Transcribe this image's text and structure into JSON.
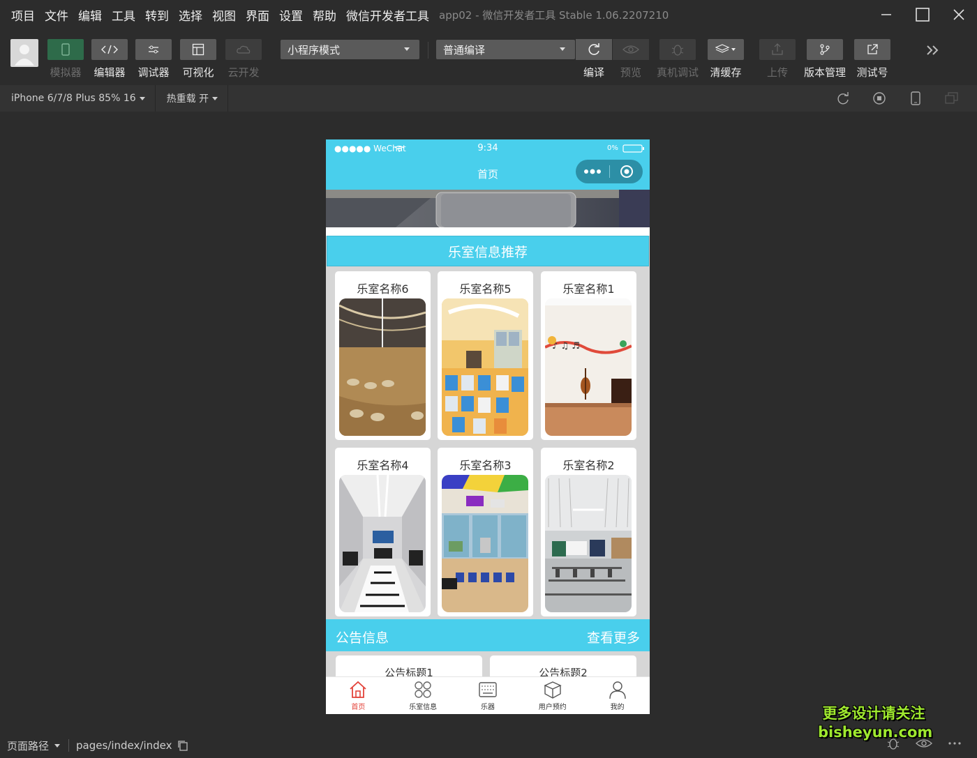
{
  "menubar": {
    "items": [
      "项目",
      "文件",
      "编辑",
      "工具",
      "转到",
      "选择",
      "视图",
      "界面",
      "设置",
      "帮助",
      "微信开发者工具"
    ],
    "app_title": "app02 - 微信开发者工具 Stable 1.06.2207210"
  },
  "toolbar": {
    "simulator": "模拟器",
    "editor": "编辑器",
    "debugger": "调试器",
    "visual": "可视化",
    "cloud": "云开发",
    "mode_select": "小程序模式",
    "compile_select": "普通编译",
    "compile": "编译",
    "preview": "预览",
    "real_debug": "真机调试",
    "clear_cache": "清缓存",
    "upload": "上传",
    "version": "版本管理",
    "test_account": "测试号"
  },
  "subbar": {
    "device": "iPhone 6/7/8 Plus 85% 16",
    "hot_reload": "热重载 开"
  },
  "phone": {
    "status": {
      "carrier": "●●●●● WeChat",
      "time": "9:34",
      "battery": "0%"
    },
    "nav_title": "首页",
    "rec_title": "乐室信息推荐",
    "rooms": [
      {
        "name": "乐室名称6",
        "image": "auditorium-steps"
      },
      {
        "name": "乐室名称5",
        "image": "classroom-desks"
      },
      {
        "name": "乐室名称1",
        "image": "music-wall-cello"
      },
      {
        "name": "乐室名称4",
        "image": "piano-room"
      },
      {
        "name": "乐室名称3",
        "image": "colorful-classroom"
      },
      {
        "name": "乐室名称2",
        "image": "lecture-hall"
      }
    ],
    "notice_title": "公告信息",
    "notice_more": "查看更多",
    "notices": [
      "公告标题1",
      "公告标题2"
    ],
    "tabs": [
      {
        "label": "首页",
        "icon": "home-icon",
        "selected": true
      },
      {
        "label": "乐室信息",
        "icon": "grid-icon",
        "selected": false
      },
      {
        "label": "乐器",
        "icon": "keyboard-icon",
        "selected": false
      },
      {
        "label": "用户预约",
        "icon": "box-icon",
        "selected": false
      },
      {
        "label": "我的",
        "icon": "user-icon",
        "selected": false
      }
    ],
    "accent_color": "#49cfec",
    "tab_selected_color": "#e3433a"
  },
  "bottombar": {
    "path_label": "页面路径",
    "path": "pages/index/index"
  },
  "watermark": {
    "line1": "更多设计请关注",
    "line2": "bisheyun.com"
  }
}
